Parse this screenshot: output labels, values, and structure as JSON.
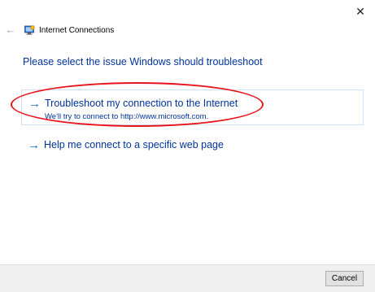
{
  "window": {
    "title": "Internet Connections",
    "close_glyph": "✕",
    "back_glyph": "←"
  },
  "main": {
    "heading": "Please select the issue Windows should troubleshoot",
    "options": [
      {
        "title": "Troubleshoot my connection to the Internet",
        "description": "We'll try to connect to http://www.microsoft.com.",
        "icon": "arrow-right-icon",
        "highlighted": true
      },
      {
        "title": "Help me connect to a specific web page",
        "icon": "arrow-right-icon"
      }
    ],
    "arrow_glyph": "→"
  },
  "footer": {
    "cancel_label": "Cancel"
  },
  "colors": {
    "link_blue": "#003399",
    "arrow_blue": "#1570c9",
    "annotation_red": "#e8141b",
    "footer_bg": "#f0f0f0"
  }
}
